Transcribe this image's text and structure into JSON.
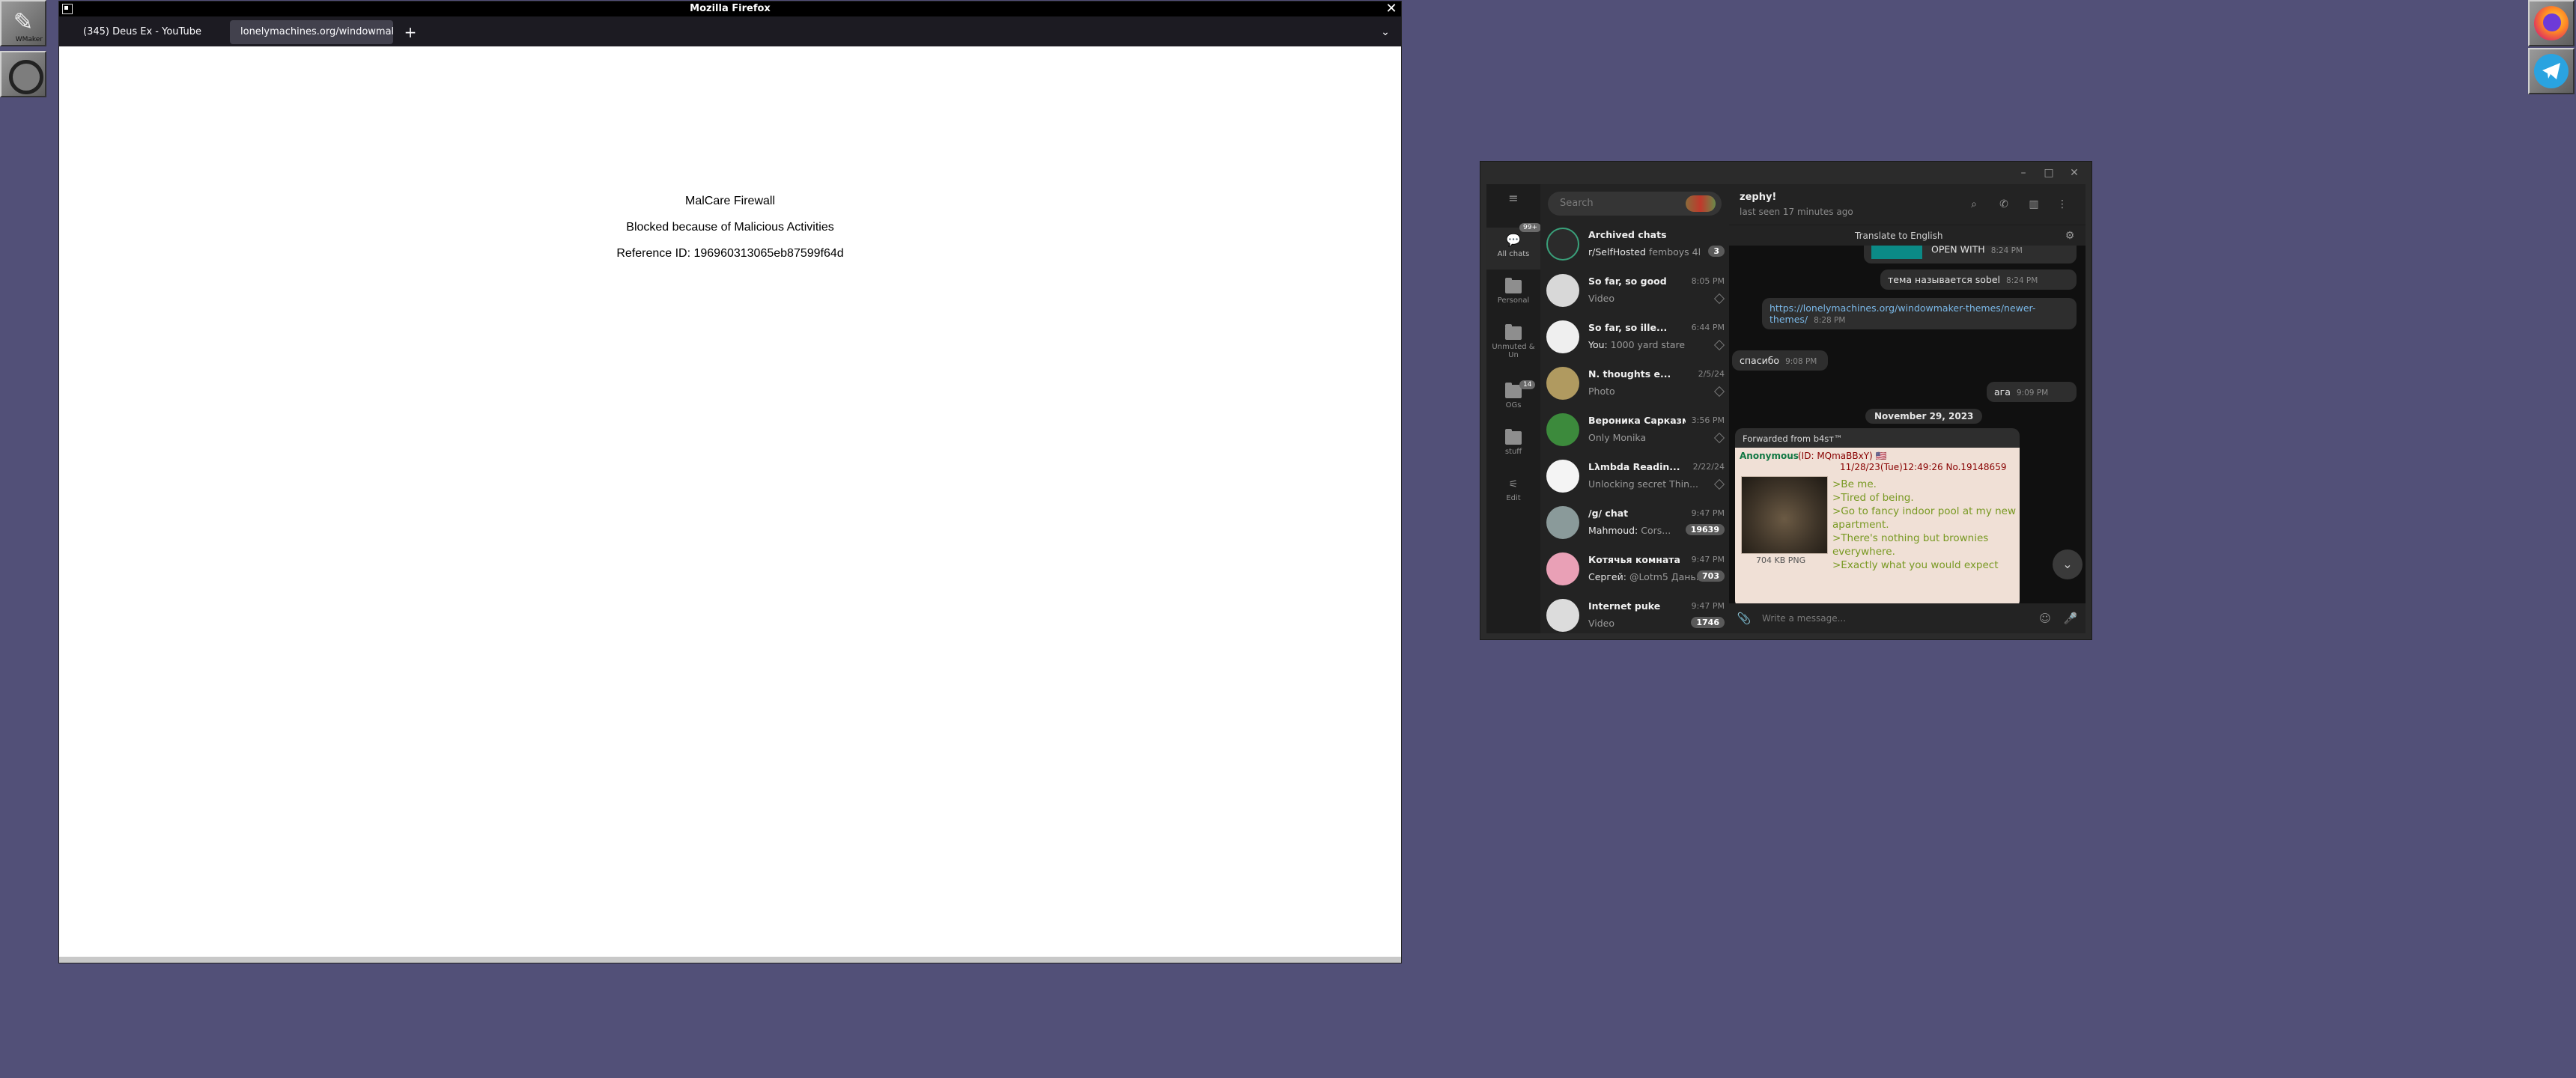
{
  "dock": {
    "left": [
      {
        "name": "windowmaker-dock-icon",
        "label": "WMaker"
      },
      {
        "name": "clip-icon"
      }
    ],
    "right": [
      {
        "name": "firefox-icon"
      },
      {
        "name": "telegram-icon"
      }
    ]
  },
  "firefox": {
    "title": "Mozilla Firefox",
    "tabs": [
      {
        "label": "(345) Deus Ex - YouTube"
      },
      {
        "label": "lonelymachines.org/windowmake"
      }
    ],
    "new_tab": "+",
    "page": {
      "title": "MalCare Firewall",
      "blocked": "Blocked because of Malicious Activities",
      "reference": "Reference ID: 196960313065eb87599f64d"
    }
  },
  "telegram": {
    "rail": [
      {
        "label": "All chats",
        "badge": "99+"
      },
      {
        "label": "Personal"
      },
      {
        "label": "Unmuted & Un"
      },
      {
        "label": "OGs",
        "badge": "14"
      },
      {
        "label": "stuff"
      },
      {
        "label": "Edit"
      }
    ],
    "search_placeholder": "Search",
    "chats": [
      {
        "name": "Archived chats",
        "preview_sender": "r/SelfHosted",
        "preview": "femboys 4l...",
        "badge": "3",
        "time": ""
      },
      {
        "name": "So far, so good",
        "time": "8:05 PM",
        "preview": "Video"
      },
      {
        "name": "So far, so ille...",
        "time": "6:44 PM",
        "preview_sender": "You:",
        "preview": "1000 yard stare"
      },
      {
        "name": "N. thoughts e...",
        "time": "2/5/24",
        "preview": "Photo"
      },
      {
        "name": "Вероника Сарказм",
        "time": "3:56 PM",
        "preview": "Only Monika"
      },
      {
        "name": "Lλmbda Readin...",
        "time": "2/22/24",
        "preview": "Unlocking secret Thin..."
      },
      {
        "name": "/g/ chat",
        "time": "9:47 PM",
        "preview_sender": "Mahmoud:",
        "preview": "Cors...",
        "badge": "19639"
      },
      {
        "name": "Котячья комната",
        "time": "9:47 PM",
        "preview_sender": "Сергей:",
        "preview": "@Lotm5 Дань...",
        "badge": "703"
      },
      {
        "name": "Internet puke",
        "time": "9:47 PM",
        "preview": "Video",
        "badge": "1746"
      }
    ],
    "header": {
      "peer": "zephy!",
      "status": "last seen 17 minutes ago"
    },
    "translate": "Translate to English",
    "messages": [
      {
        "text": "OPEN WITH",
        "time": "8:24 PM"
      },
      {
        "text": "тема называется sobel",
        "time": "8:24 PM"
      },
      {
        "text": "https://lonelymachines.org/windowmaker-themes/newer-themes/",
        "time": "8:28 PM"
      },
      {
        "text": "спасибо",
        "time": "9:08 PM"
      },
      {
        "text": "ага",
        "time": "9:09 PM"
      }
    ],
    "date_separator": "November 29, 2023",
    "forward": {
      "from": "Forwarded from b4sт™",
      "author": "Anonymous",
      "id": "(ID: MQmaBBxY) 🇺🇸",
      "date": "11/28/23(Tue)12:49:26 No.19148659",
      "image_size": "704 KB PNG",
      "lines": [
        ">Be me.",
        ">Tired of being.",
        ">Go to fancy indoor pool at my new apartment.",
        ">There's nothing but brownies everywhere.",
        ">Exactly what you would expect"
      ]
    },
    "compose_placeholder": "Write a message..."
  }
}
